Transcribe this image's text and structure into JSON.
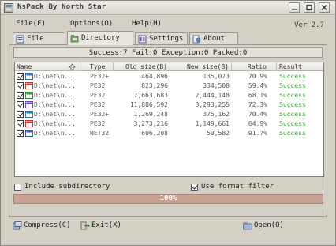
{
  "window": {
    "title": "NsPack By North Star",
    "version": "Ver 2.7"
  },
  "menu": {
    "file": "File(F)",
    "options": "Options(O)",
    "help": "Help(H)"
  },
  "tabs": [
    {
      "label": "File",
      "icon": "file-icon"
    },
    {
      "label": "Directory",
      "icon": "folder-icon"
    },
    {
      "label": "Settings",
      "icon": "settings-icon"
    },
    {
      "label": "About",
      "icon": "about-icon"
    }
  ],
  "status_line": "Success:7 Fail:0 Exception:0 Packed:0",
  "table": {
    "columns": [
      "Name",
      "Type",
      "Old size(B)",
      "New size(B)",
      "Ratio",
      "Result"
    ],
    "rows": [
      {
        "name": "D:\\net\\n...",
        "type": "PE32+",
        "old": "464,896",
        "new": "135,073",
        "ratio": "70.9%",
        "result": "Success"
      },
      {
        "name": "D:\\net\\n...",
        "type": "PE32",
        "old": "823,296",
        "new": "334,508",
        "ratio": "59.4%",
        "result": "Success"
      },
      {
        "name": "D:\\net\\n...",
        "type": "PE32",
        "old": "7,663,683",
        "new": "2,444,148",
        "ratio": "68.1%",
        "result": "Success"
      },
      {
        "name": "D:\\net\\n...",
        "type": "PE32",
        "old": "11,886,592",
        "new": "3,293,255",
        "ratio": "72.3%",
        "result": "Success"
      },
      {
        "name": "D:\\net\\n...",
        "type": "PE32+",
        "old": "1,269,248",
        "new": "375,162",
        "ratio": "70.4%",
        "result": "Success"
      },
      {
        "name": "D:\\net\\n...",
        "type": "PE32",
        "old": "3,273,216",
        "new": "1,149,661",
        "ratio": "64.9%",
        "result": "Success"
      },
      {
        "name": "D:\\net\\n...",
        "type": "NET32",
        "old": "606,208",
        "new": "50,582",
        "ratio": "91.7%",
        "result": "Success"
      }
    ]
  },
  "options": {
    "include_subdirectory": {
      "label": "Include subdirectory",
      "checked": false
    },
    "use_format_filter": {
      "label": "Use format filter",
      "checked": true
    }
  },
  "progress": {
    "value": 1.0,
    "text": "100%"
  },
  "buttons": {
    "compress": "Compress(C)",
    "exit": "Exit(X)",
    "open": "Open(O)"
  },
  "colors": {
    "success": "#3a9a3a",
    "progress": "#c9a192"
  }
}
